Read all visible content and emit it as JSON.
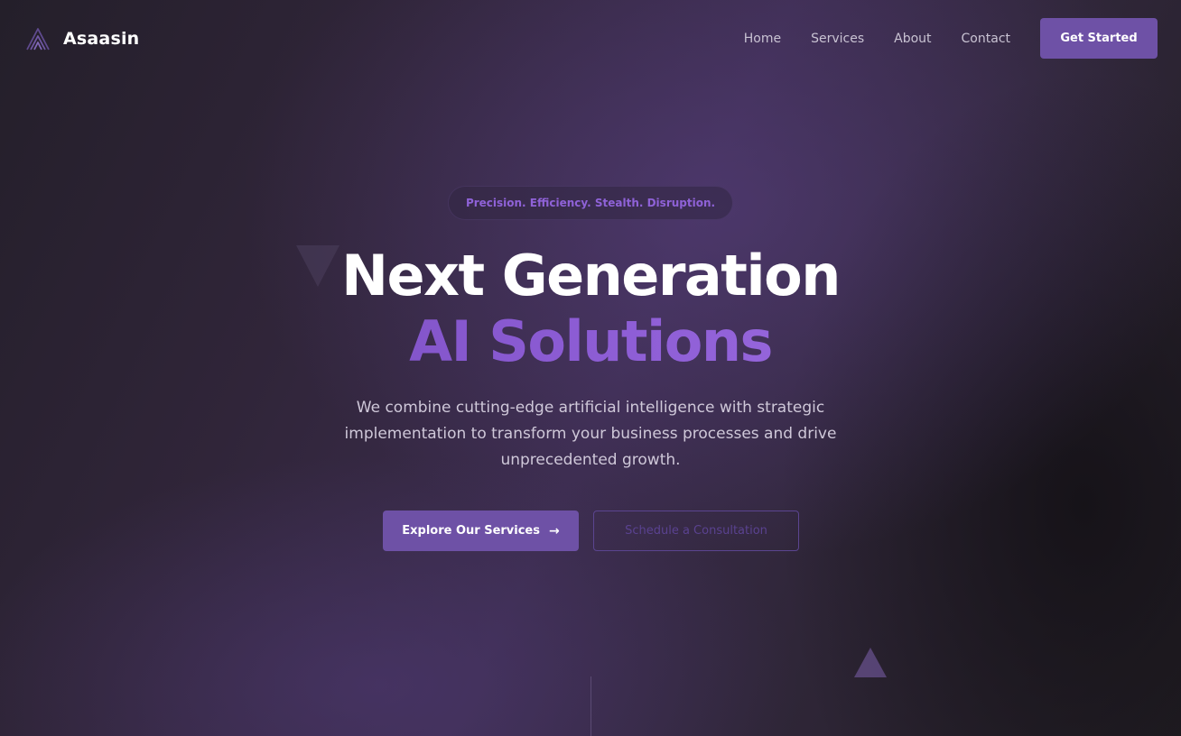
{
  "brand": {
    "name": "Asaasin",
    "logo_icon": "stacked-triangle-logo-icon"
  },
  "nav": {
    "links": [
      "Home",
      "Services",
      "About",
      "Contact"
    ],
    "cta_label": "Get Started"
  },
  "hero": {
    "tagline": "Precision. Efficiency. Stealth. Disruption.",
    "headline_line1": "Next Generation",
    "headline_line2": "AI Solutions",
    "subtext": "We combine cutting-edge artificial intelligence with strategic implementation to transform your business processes and drive unprecedented growth.",
    "primary_button": "Explore Our Services",
    "primary_button_icon": "arrow-right-icon",
    "secondary_button": "Schedule a Consultation"
  },
  "colors": {
    "accent": "#6e51a6",
    "accent_text": "#8f62d8",
    "headline_gradient_start": "#6f49b3",
    "headline_gradient_end": "#a676ea",
    "background_dark": "#241f2a",
    "background_mid": "#3b2c4d"
  }
}
